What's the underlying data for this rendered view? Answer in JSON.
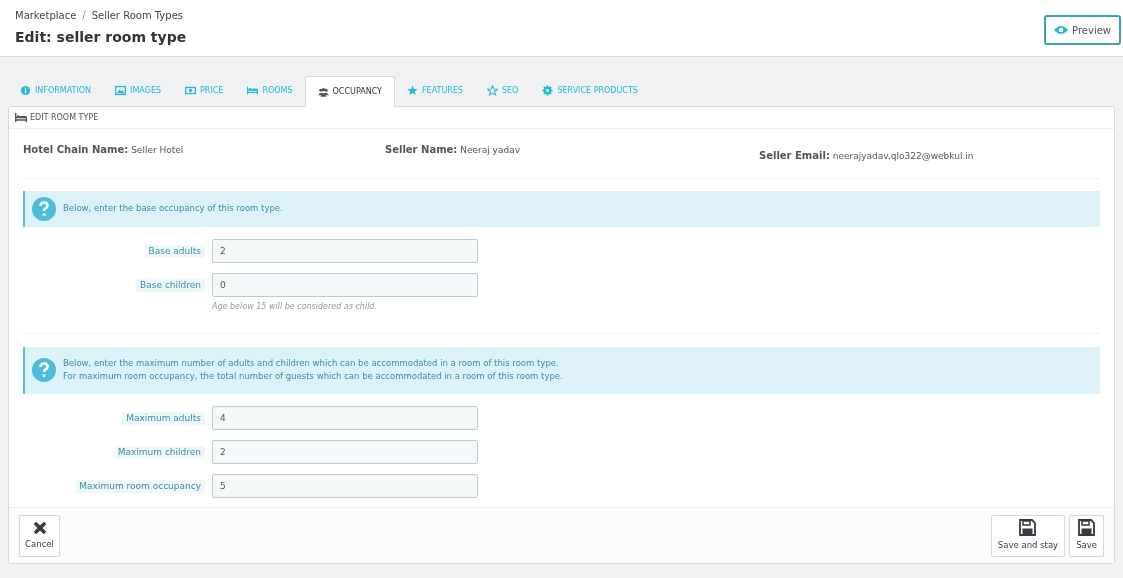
{
  "breadcrumb": [
    "Marketplace",
    "Seller Room Types"
  ],
  "breadcrumb_separator": "/",
  "title": "Edit: seller room type",
  "preview_button": "Preview",
  "tabs": [
    {
      "label": "INFORMATION",
      "selected": false
    },
    {
      "label": "IMAGES",
      "selected": false
    },
    {
      "label": "PRICE",
      "selected": false
    },
    {
      "label": "ROOMS",
      "selected": false
    },
    {
      "label": "OCCUPANCY",
      "selected": true
    },
    {
      "label": "FEATURES",
      "selected": false
    },
    {
      "label": "SEO",
      "selected": false
    },
    {
      "label": "SERVICE PRODUCTS",
      "selected": false
    }
  ],
  "panel_title": "EDIT ROOM TYPE",
  "info": [
    {
      "label": "Hotel Chain Name:",
      "value": "Seller Hotel"
    },
    {
      "label": "Seller Name:",
      "value": "Neeraj yadav"
    },
    {
      "label": "Seller Email:",
      "value": "neerajyadav.qlo322@webkul.in"
    }
  ],
  "sections": [
    {
      "alert": [
        "Below, enter the base occupancy of this room type."
      ],
      "fields": [
        {
          "label": "Base adults",
          "value": "2"
        },
        {
          "label": "Base children",
          "value": "0",
          "hint": "Age below 15 will be considered as child."
        }
      ]
    },
    {
      "alert": [
        "Below, enter the maximum number of adults and children which can be accommodated in a room of this room type.",
        "For maximum room occupancy, the total number of guests which can be accommodated in a room of this room type."
      ],
      "fields": [
        {
          "label": "Maximum adults",
          "value": "4"
        },
        {
          "label": "Maximum children",
          "value": "2"
        },
        {
          "label": "Maximum room occupancy",
          "value": "5"
        }
      ]
    }
  ],
  "footer": {
    "cancel": "Cancel",
    "save_and_stay": "Save and stay",
    "save": "Save"
  }
}
